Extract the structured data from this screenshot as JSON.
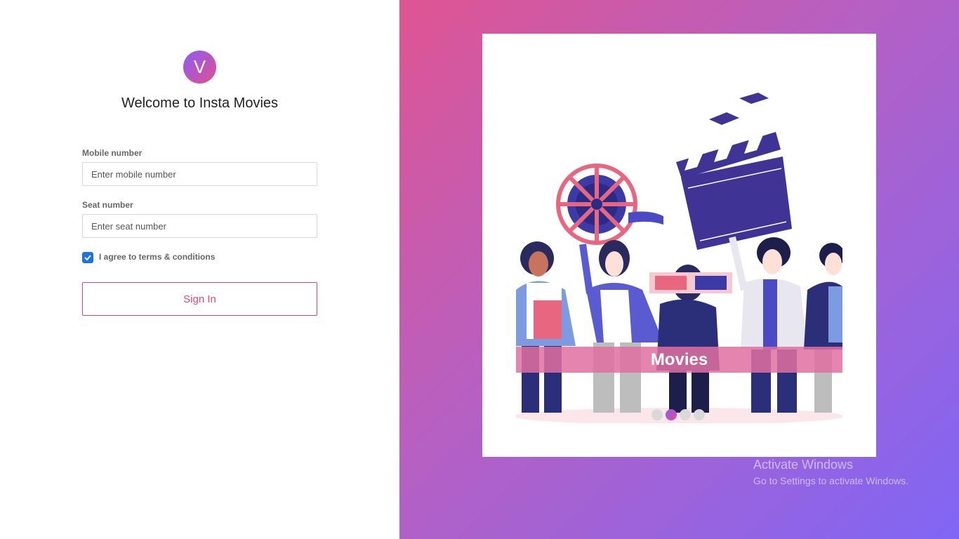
{
  "logo": {
    "letter": "V"
  },
  "welcome_title": "Welcome to Insta Movies",
  "form": {
    "mobile": {
      "label": "Mobile number",
      "placeholder": "Enter mobile number",
      "value": ""
    },
    "seat": {
      "label": "Seat number",
      "placeholder": "Enter seat number",
      "value": ""
    },
    "terms": {
      "label": "I agree to terms & conditions",
      "checked": true
    },
    "signin_label": "Sign In"
  },
  "carousel": {
    "caption": "Movies",
    "slide_count": 4,
    "active_index": 1
  },
  "watermark": {
    "title": "Activate Windows",
    "subtitle": "Go to Settings to activate Windows."
  },
  "colors": {
    "accent": "#e0457a",
    "checkbox": "#1a73e8",
    "gradient_start": "#df5592",
    "gradient_end": "#8066f5"
  },
  "icons": [
    "logo-v-icon",
    "checkmark-icon",
    "movie-illustration"
  ]
}
